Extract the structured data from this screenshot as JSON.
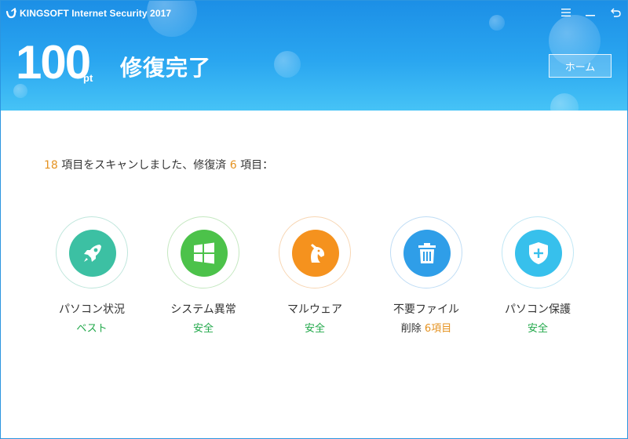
{
  "app": {
    "title": "KINGSOFT Internet Security 2017"
  },
  "window_controls": {
    "menu_icon": "menu-icon",
    "minimize_icon": "minimize-icon",
    "back_icon": "back-icon"
  },
  "header": {
    "score": "100",
    "score_unit": "pt",
    "status": "修復完了",
    "home_label": "ホーム"
  },
  "summary": {
    "scanned_count": "18",
    "text_part1": " 項目をスキャンしました、修復済 ",
    "fixed_count": "6",
    "text_part2": " 項目："
  },
  "items": [
    {
      "icon": "rocket-icon",
      "label": "パソコン状況",
      "status": "ベスト",
      "color": "#3cc0a3"
    },
    {
      "icon": "windows-logo-icon",
      "label": "システム異常",
      "status": "安全",
      "color": "#4cc24a"
    },
    {
      "icon": "horse-head-icon",
      "label": "マルウェア",
      "status": "安全",
      "color": "#f5921e"
    },
    {
      "icon": "trash-icon",
      "label": "不要ファイル",
      "status_prefix": "削除 ",
      "status_count": "6",
      "status_suffix": "項目",
      "color": "#2f9ee8"
    },
    {
      "icon": "shield-plus-icon",
      "label": "パソコン保護",
      "status": "安全",
      "color": "#37c0ec"
    }
  ],
  "colors": {
    "header_top": "#1c8fe6",
    "header_bottom": "#46c3f6",
    "accent_orange": "#e59322",
    "safe_green": "#21a84a"
  }
}
